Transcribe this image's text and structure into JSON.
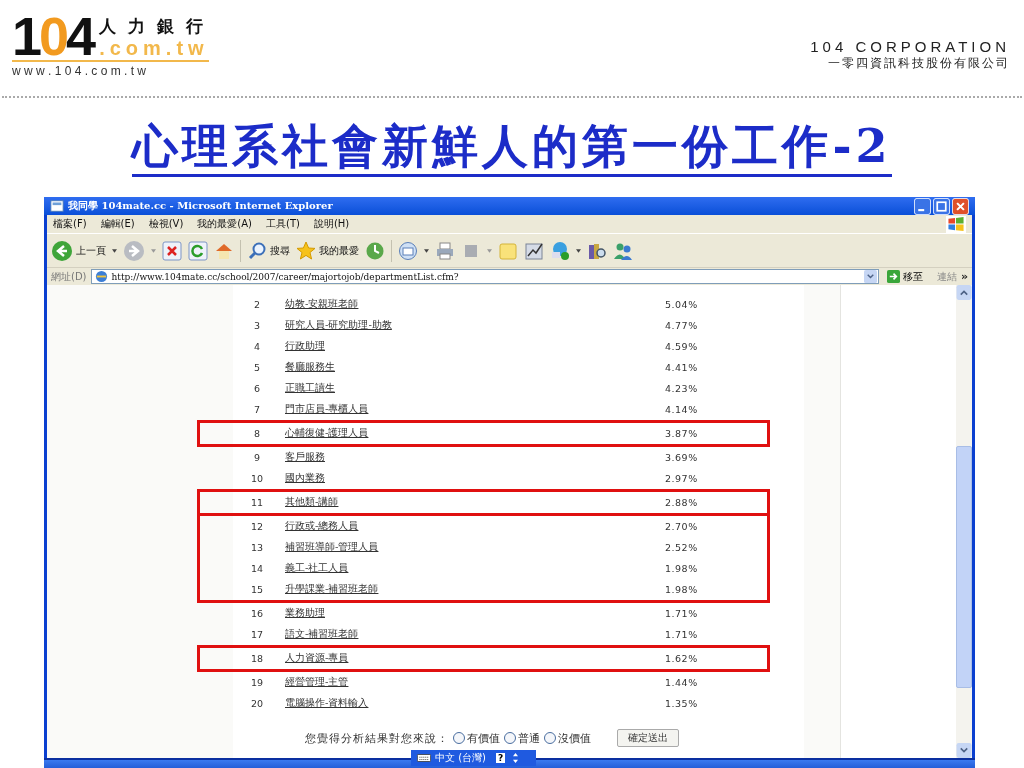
{
  "header": {
    "logo_number": "104",
    "logo_tagline": "人 力 銀 行",
    "logo_domain": ".com.tw",
    "logo_url": "w w w . 1 0 4 . c o m . t w",
    "corp_name": "104 CORPORATION",
    "corp_name_zh": "一零四資訊科技股份有限公司"
  },
  "slide_title": "心理系社會新鮮人的第一份工作-2",
  "window": {
    "title": "我同學 104mate.cc - Microsoft Internet Explorer",
    "menu": [
      "檔案(F)",
      "編輯(E)",
      "檢視(V)",
      "我的最愛(A)",
      "工具(T)",
      "說明(H)"
    ],
    "toolbar": {
      "back": "上一頁",
      "search": "搜尋",
      "favorites": "我的最愛"
    },
    "address": {
      "label": "網址(D)",
      "url": "http://www.104mate.cc/school/2007/career/majortojob/departmentList.cfm?",
      "go": "移至",
      "links": "連結",
      "more": "»"
    }
  },
  "row_groups": [
    {
      "marked": false,
      "rows": [
        {
          "rank": "2",
          "job": "幼教-安親班老師",
          "share": "5.04%"
        },
        {
          "rank": "3",
          "job": "研究人員-研究助理-助教",
          "share": "4.77%"
        },
        {
          "rank": "4",
          "job": "行政助理",
          "share": "4.59%"
        },
        {
          "rank": "5",
          "job": "餐廳服務生",
          "share": "4.41%"
        },
        {
          "rank": "6",
          "job": "正職工讀生",
          "share": "4.23%"
        },
        {
          "rank": "7",
          "job": "門市店員-專櫃人員",
          "share": "4.14%"
        }
      ]
    },
    {
      "marked": true,
      "rows": [
        {
          "rank": "8",
          "job": "心輔復健-護理人員",
          "share": "3.87%"
        }
      ]
    },
    {
      "marked": false,
      "rows": [
        {
          "rank": "9",
          "job": "客戶服務",
          "share": "3.69%"
        },
        {
          "rank": "10",
          "job": "國內業務",
          "share": "2.97%"
        }
      ]
    },
    {
      "marked": true,
      "rows": [
        {
          "rank": "11",
          "job": "其他類-講師",
          "share": "2.88%"
        }
      ]
    },
    {
      "marked": true,
      "rows": [
        {
          "rank": "12",
          "job": "行政或-總務人員",
          "share": "2.70%"
        },
        {
          "rank": "13",
          "job": "補習班導師-管理人員",
          "share": "2.52%"
        },
        {
          "rank": "14",
          "job": "義工-社工人員",
          "share": "1.98%"
        },
        {
          "rank": "15",
          "job": "升學課業-補習班老師",
          "share": "1.98%"
        }
      ]
    },
    {
      "marked": false,
      "rows": [
        {
          "rank": "16",
          "job": "業務助理",
          "share": "1.71%"
        },
        {
          "rank": "17",
          "job": "語文-補習班老師",
          "share": "1.71%"
        }
      ]
    },
    {
      "marked": true,
      "rows": [
        {
          "rank": "18",
          "job": "人力資源-專員",
          "share": "1.62%"
        }
      ]
    },
    {
      "marked": false,
      "rows": [
        {
          "rank": "19",
          "job": "經營管理-主管",
          "share": "1.44%"
        },
        {
          "rank": "20",
          "job": "電腦操作-資料輸入",
          "share": "1.35%"
        }
      ]
    }
  ],
  "survey": {
    "question": "您覺得分析結果對您來說：",
    "options": [
      {
        "label": "有價值",
        "selected": false
      },
      {
        "label": "普通",
        "selected": false
      },
      {
        "label": "沒價值",
        "selected": false
      }
    ],
    "submit": "確定送出"
  },
  "ime_bar": {
    "label": "中文 (台灣)",
    "help": "?"
  }
}
